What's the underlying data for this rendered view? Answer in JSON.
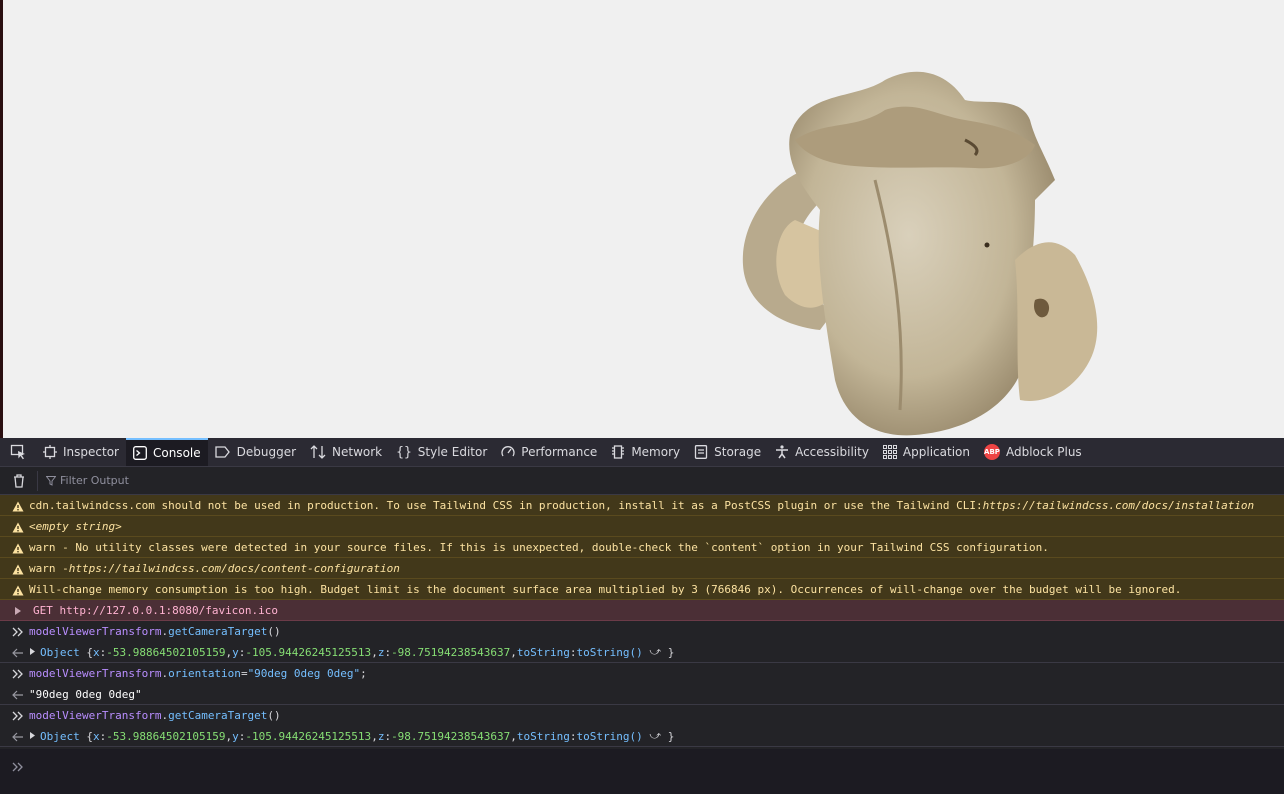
{
  "devtools": {
    "tabs": [
      {
        "label": "Inspector",
        "icon": "inspector-icon"
      },
      {
        "label": "Console",
        "icon": "console-icon"
      },
      {
        "label": "Debugger",
        "icon": "debugger-icon"
      },
      {
        "label": "Network",
        "icon": "network-icon"
      },
      {
        "label": "Style Editor",
        "icon": "style-editor-icon"
      },
      {
        "label": "Performance",
        "icon": "performance-icon"
      },
      {
        "label": "Memory",
        "icon": "memory-icon"
      },
      {
        "label": "Storage",
        "icon": "storage-icon"
      },
      {
        "label": "Accessibility",
        "icon": "accessibility-icon"
      },
      {
        "label": "Application",
        "icon": "application-icon"
      },
      {
        "label": "Adblock Plus",
        "icon": "adblock-plus-icon",
        "badge": "ABP"
      }
    ],
    "active_tab": "Console",
    "filter_placeholder": "Filter Output",
    "colors": {
      "warning_bg": "#42381a",
      "error_bg": "#4b2f36",
      "active_tab_accent": "#75bfff"
    }
  },
  "console": {
    "warnings": [
      {
        "text": "cdn.tailwindcss.com should not be used in production. To use Tailwind CSS in production, install it as a PostCSS plugin or use the Tailwind CLI: ",
        "link": "https://tailwindcss.com/docs/installation"
      },
      {
        "text": "<empty string>"
      },
      {
        "text": "warn - No utility classes were detected in your source files. If this is unexpected, double-check the `content` option in your Tailwind CSS configuration."
      },
      {
        "prefix": "warn - ",
        "link": "https://tailwindcss.com/docs/content-configuration"
      },
      {
        "text": "Will-change memory consumption is too high. Budget limit is the document surface area multiplied by 3 (766846 px). Occurrences of will-change over the budget will be ignored."
      }
    ],
    "network_error": {
      "method": "GET",
      "url": "http://127.0.0.1:8080/favicon.ico"
    },
    "entries": [
      {
        "input": {
          "object": "modelViewerTransform",
          "member": "getCameraTarget",
          "suffix": "()"
        },
        "output": {
          "label": "Object",
          "x": "-53.98864502105159",
          "y": "-105.94426245125513",
          "z": "-98.75194238543637",
          "fn": "toString()"
        }
      },
      {
        "input": {
          "object": "modelViewerTransform",
          "member": "orientation",
          "op": " = ",
          "value": "\"90deg 0deg 0deg\"",
          "end": ";"
        },
        "output": {
          "text": "\"90deg 0deg 0deg\""
        }
      },
      {
        "input": {
          "object": "modelViewerTransform",
          "member": "getCameraTarget",
          "suffix": "()"
        },
        "output": {
          "label": "Object",
          "x": "-53.98864502105159",
          "y": "-105.94426245125513",
          "z": "-98.75194238543637",
          "fn": "toString()"
        }
      }
    ]
  }
}
